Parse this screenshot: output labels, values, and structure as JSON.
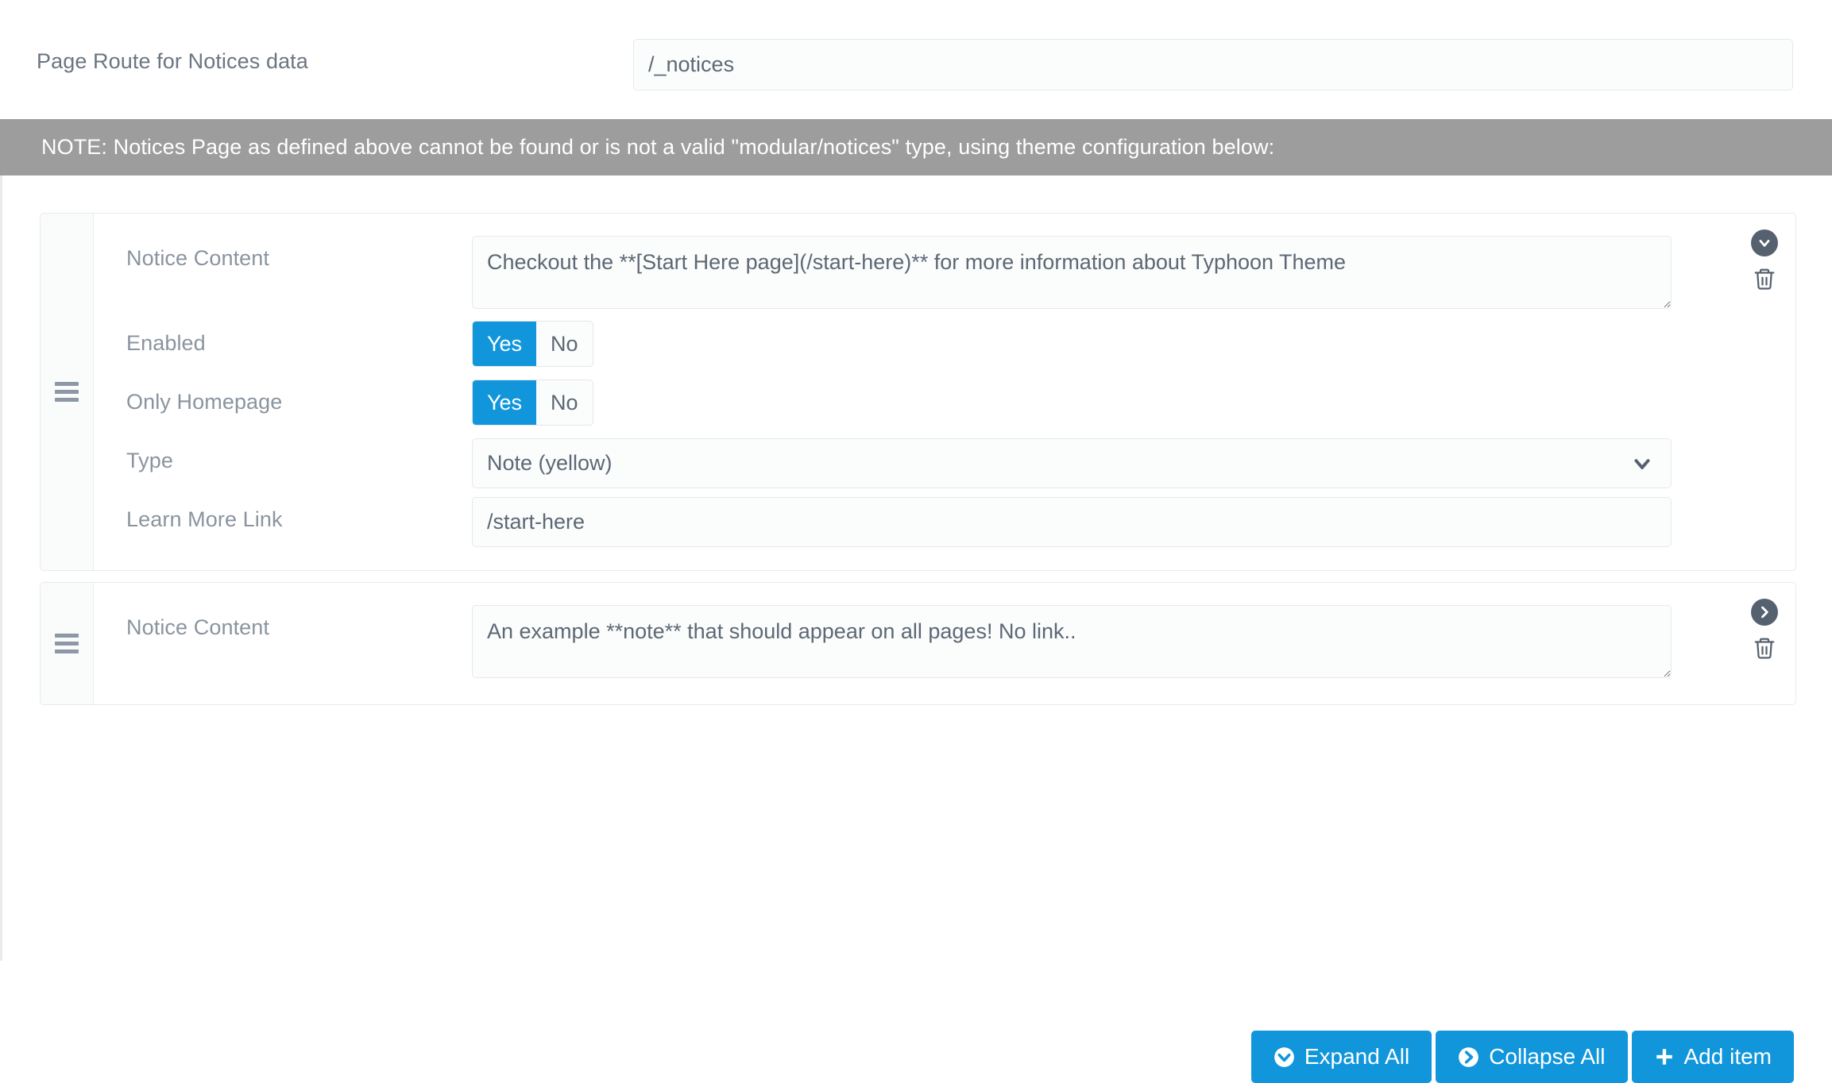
{
  "top_field": {
    "label": "Page Route for Notices data",
    "value": "/_notices",
    "placeholder": ""
  },
  "note_banner": {
    "text": "NOTE: Notices Page as defined above cannot be found or is not a valid \"modular/notices\" type, using theme configuration below:"
  },
  "items": [
    {
      "expanded": true,
      "notice_content_label": "Notice Content",
      "notice_content_value": "Checkout the **[Start Here page](/start-here)** for more information about Typhoon Theme",
      "enabled_label": "Enabled",
      "enabled_yes": "Yes",
      "enabled_no": "No",
      "enabled_selected": "Yes",
      "only_homepage_label": "Only Homepage",
      "only_homepage_yes": "Yes",
      "only_homepage_no": "No",
      "only_homepage_selected": "Yes",
      "type_label": "Type",
      "type_value": "Note (yellow)",
      "learn_more_label": "Learn More Link",
      "learn_more_value": "/start-here"
    },
    {
      "expanded": false,
      "notice_content_label": "Notice Content",
      "notice_content_value": "An example **note** that should appear on all pages! No link.."
    }
  ],
  "buttons": {
    "expand_all": "Expand All",
    "collapse_all": "Collapse All",
    "add_item": "Add item"
  },
  "colors": {
    "accent_blue": "#1296db",
    "banner_gray": "#9d9d9d",
    "icon_dark": "#56616f",
    "label_gray": "#8a949f"
  }
}
